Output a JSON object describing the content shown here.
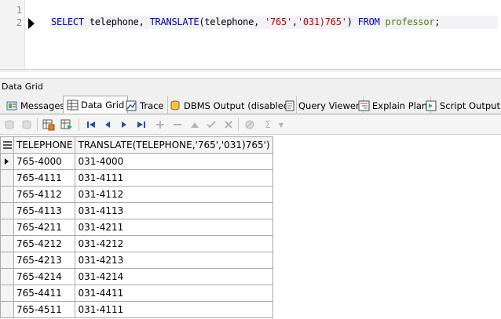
{
  "editor": {
    "line_numbers": [
      "1",
      "2"
    ],
    "code": {
      "kw_select": "SELECT",
      "col": " telephone, ",
      "fn": "TRANSLATE",
      "open": "(telephone, ",
      "str1": "'765'",
      "comma": ",",
      "str2": "'031)765'",
      "close": ") ",
      "kw_from": "FROM",
      "space": " ",
      "table": "professor",
      "semi": ";"
    }
  },
  "panel": {
    "title": "Data Grid"
  },
  "tabs": [
    {
      "label": "Messages",
      "icon": "messages-icon"
    },
    {
      "label": "Data Grid",
      "icon": "data-grid-icon",
      "active": true
    },
    {
      "label": "Trace",
      "icon": "trace-icon"
    },
    {
      "label": "DBMS Output (disabled)",
      "icon": "dbms-output-icon"
    },
    {
      "label": "Query Viewer",
      "icon": "query-viewer-icon"
    },
    {
      "label": "Explain Plan",
      "icon": "explain-plan-icon"
    },
    {
      "label": "Script Output",
      "icon": "script-output-icon"
    }
  ],
  "toolbar": {
    "icons": [
      "commit-icon",
      "rollback-icon",
      "export-icon",
      "refresh-icon",
      "first-record-icon",
      "prior-record-icon",
      "next-record-icon",
      "last-record-icon",
      "insert-record-icon",
      "delete-record-icon",
      "edit-record-icon",
      "post-edit-icon",
      "cancel-edit-icon",
      "filter-icon",
      "sum-icon"
    ]
  },
  "grid": {
    "columns": [
      "TELEPHONE",
      "TRANSLATE(TELEPHONE,'765','031)765')"
    ],
    "rows": [
      [
        "765-4000",
        "031-4000"
      ],
      [
        "765-4111",
        "031-4111"
      ],
      [
        "765-4112",
        "031-4112"
      ],
      [
        "765-4113",
        "031-4113"
      ],
      [
        "765-4211",
        "031-4211"
      ],
      [
        "765-4212",
        "031-4212"
      ],
      [
        "765-4213",
        "031-4213"
      ],
      [
        "765-4214",
        "031-4214"
      ],
      [
        "765-4411",
        "031-4411"
      ],
      [
        "765-4511",
        "031-4111"
      ]
    ],
    "current_row": 0
  },
  "colors": {
    "keyword": "#0000c8",
    "string": "#c00000",
    "table_name": "#5a7a00",
    "panel_bg": "#f0f0f0"
  }
}
